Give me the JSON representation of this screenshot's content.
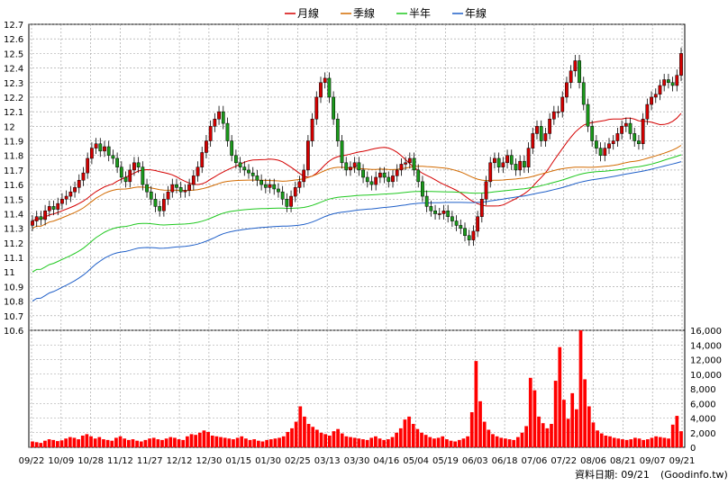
{
  "legend": [
    {
      "label": "月線",
      "color": "#d40000"
    },
    {
      "label": "季線",
      "color": "#d26a00"
    },
    {
      "label": "半年",
      "color": "#1fc81f"
    },
    {
      "label": "年線",
      "color": "#1f5fc8"
    }
  ],
  "footer": {
    "date_text": "資料日期: 09/21",
    "source": "(Goodinfo.tw)"
  },
  "colors": {
    "up": "#d40000",
    "down": "#1a9a1a",
    "volume": "#ff0000",
    "grid": "#9a9a9a",
    "background": "#ffffff"
  },
  "chart_data": {
    "type": "candlestick",
    "x_ticks": [
      "09/22",
      "10/09",
      "10/28",
      "11/12",
      "11/27",
      "12/12",
      "12/30",
      "01/15",
      "01/30",
      "02/25",
      "03/13",
      "03/30",
      "04/16",
      "05/04",
      "05/19",
      "06/03",
      "06/18",
      "07/06",
      "07/22",
      "08/06",
      "08/21",
      "09/07",
      "09/21"
    ],
    "price_axis": {
      "ticks": [
        "10.6",
        "10.7",
        "10.8",
        "10.9",
        "11",
        "11.1",
        "11.2",
        "11.3",
        "11.4",
        "11.5",
        "11.6",
        "11.7",
        "11.8",
        "11.9",
        "12",
        "12.1",
        "12.2",
        "12.3",
        "12.4",
        "12.5",
        "12.6",
        "12.7"
      ],
      "range": [
        10.6,
        12.7
      ]
    },
    "volume_axis": {
      "ticks": [
        "0",
        "2,000",
        "4,000",
        "6,000",
        "8,000",
        "10,000",
        "12,000",
        "14,000",
        "16,000"
      ],
      "range": [
        0,
        16000
      ]
    },
    "close": [
      11.35,
      11.38,
      11.36,
      11.42,
      11.45,
      11.43,
      11.47,
      11.5,
      11.52,
      11.55,
      11.58,
      11.63,
      11.68,
      11.78,
      11.85,
      11.88,
      11.83,
      11.86,
      11.8,
      11.78,
      11.72,
      11.65,
      11.62,
      11.7,
      11.75,
      11.72,
      11.6,
      11.55,
      11.5,
      11.45,
      11.42,
      11.5,
      11.55,
      11.6,
      11.58,
      11.55,
      11.56,
      11.6,
      11.66,
      11.72,
      11.82,
      11.9,
      12,
      12.05,
      12.1,
      12.02,
      11.9,
      11.8,
      11.75,
      11.72,
      11.7,
      11.68,
      11.66,
      11.63,
      11.6,
      11.58,
      11.6,
      11.57,
      11.55,
      11.5,
      11.45,
      11.52,
      11.58,
      11.62,
      11.7,
      11.9,
      12.05,
      12.2,
      12.3,
      12.33,
      12.2,
      12.05,
      11.9,
      11.75,
      11.7,
      11.72,
      11.75,
      11.7,
      11.65,
      11.62,
      11.6,
      11.65,
      11.68,
      11.65,
      11.62,
      11.66,
      11.7,
      11.74,
      11.75,
      11.78,
      11.7,
      11.62,
      11.52,
      11.45,
      11.42,
      11.4,
      11.4,
      11.42,
      11.38,
      11.35,
      11.32,
      11.3,
      11.25,
      11.22,
      11.28,
      11.38,
      11.5,
      11.62,
      11.75,
      11.78,
      11.72,
      11.75,
      11.8,
      11.74,
      11.7,
      11.76,
      11.72,
      11.85,
      11.95,
      12,
      11.9,
      11.95,
      12.05,
      12.1,
      12.1,
      12.2,
      12.3,
      12.38,
      12.45,
      12.3,
      12.15,
      12,
      11.9,
      11.85,
      11.8,
      11.85,
      11.88,
      11.9,
      11.95,
      12,
      12.02,
      11.95,
      11.9,
      11.88,
      12.05,
      12.15,
      12.2,
      12.22,
      12.28,
      12.32,
      12.3,
      12.28,
      12.35,
      12.5
    ],
    "volume": [
      800,
      700,
      600,
      900,
      1100,
      1000,
      850,
      950,
      1200,
      1400,
      1300,
      1100,
      1600,
      1800,
      1500,
      1200,
      1400,
      1100,
      1000,
      900,
      1300,
      1500,
      1200,
      1000,
      1100,
      900,
      800,
      1000,
      1200,
      1300,
      1100,
      1000,
      1200,
      1400,
      1300,
      1100,
      1000,
      1500,
      1800,
      1700,
      2000,
      2300,
      2100,
      1600,
      1500,
      1400,
      1300,
      1200,
      1100,
      1300,
      1500,
      1200,
      1000,
      1100,
      900,
      800,
      1000,
      1100,
      1200,
      1300,
      1500,
      2100,
      2600,
      3500,
      5600,
      4200,
      3200,
      2800,
      2400,
      2000,
      1800,
      1600,
      2200,
      2500,
      1900,
      1500,
      1400,
      1300,
      1200,
      1100,
      1000,
      1300,
      1500,
      1200,
      1000,
      1100,
      1400,
      2000,
      2600,
      3800,
      4200,
      3200,
      2500,
      2000,
      1700,
      1400,
      1200,
      1300,
      1500,
      1100,
      900,
      800,
      1000,
      1200,
      1500,
      4800,
      11800,
      6300,
      3500,
      2400,
      1800,
      1500,
      1300,
      1200,
      1100,
      1000,
      1400,
      2000,
      2900,
      9500,
      7800,
      4200,
      3300,
      2600,
      3200,
      9100,
      13700,
      6500,
      3900,
      7400,
      5200,
      16000,
      9300,
      5600,
      3400,
      2300,
      1900,
      1600,
      1500,
      1300,
      1200,
      1100,
      1000,
      1100,
      1300,
      1200,
      1000,
      1100,
      1300,
      1500,
      1400,
      1300,
      1200,
      3100,
      4300,
      2200
    ]
  }
}
